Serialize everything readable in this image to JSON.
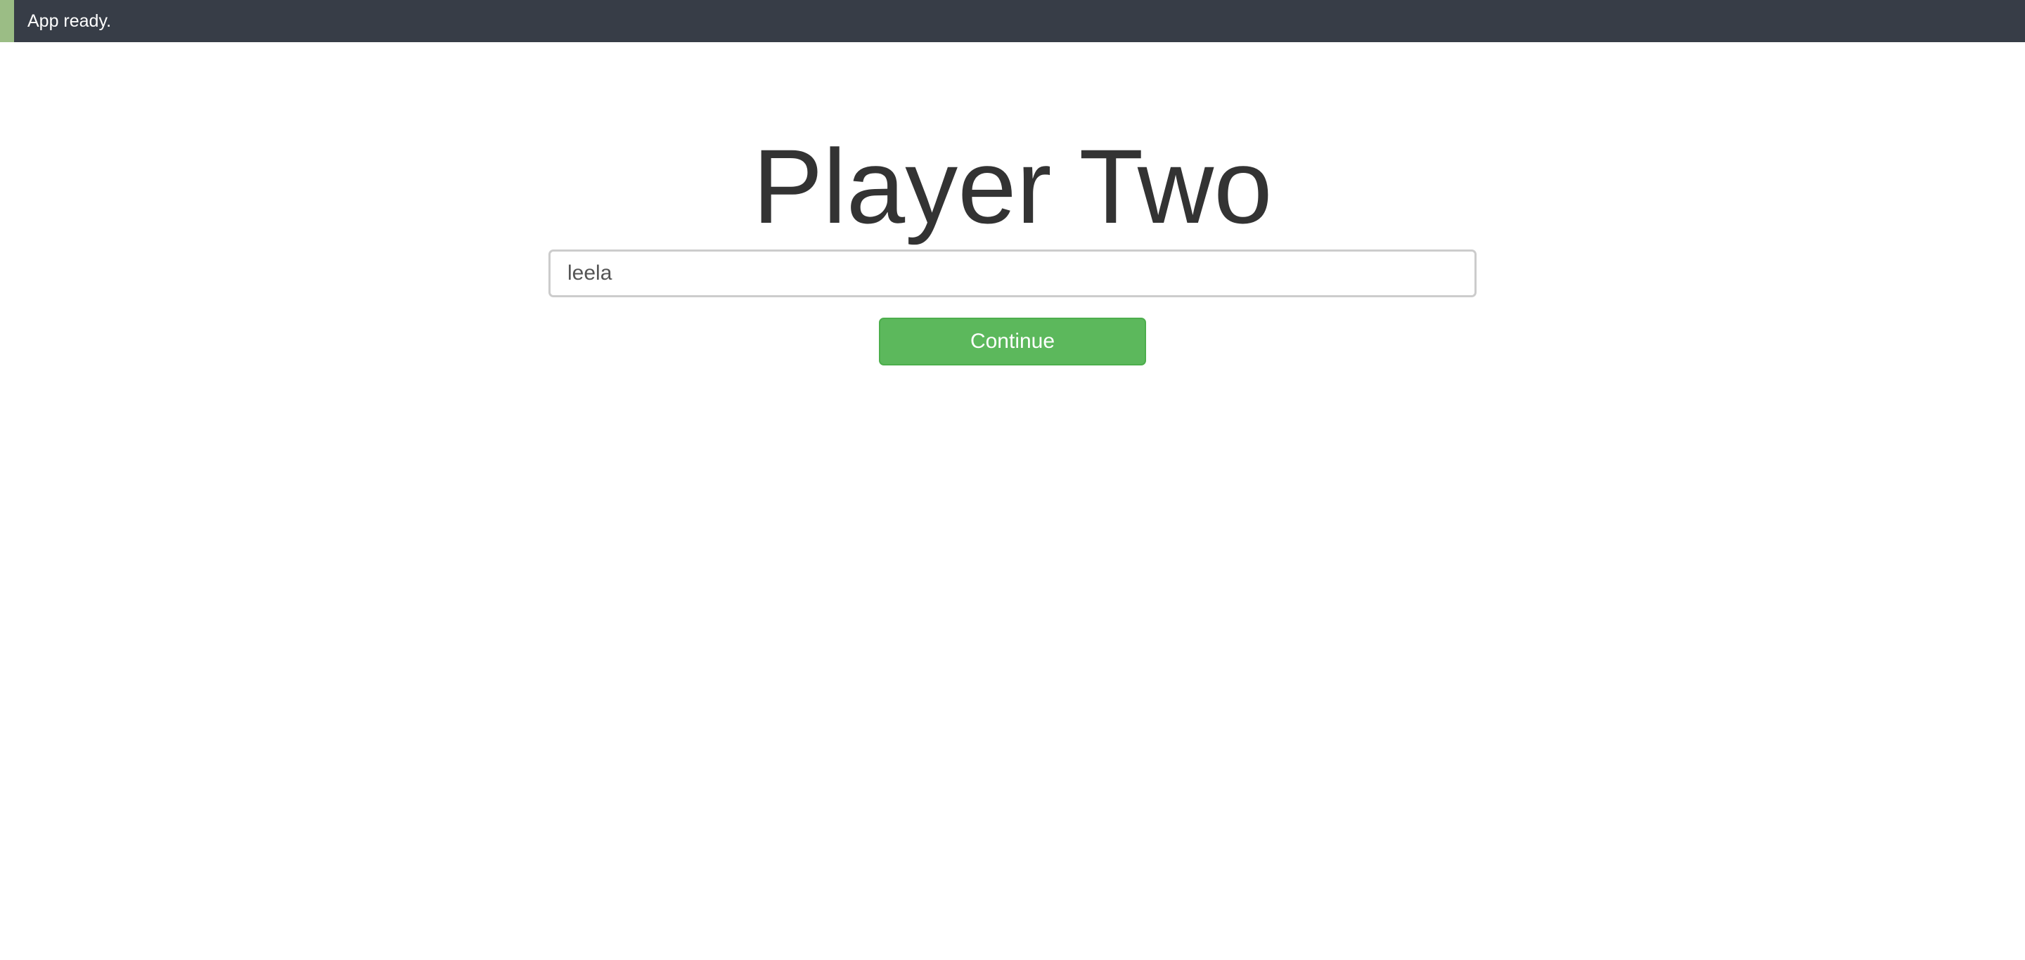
{
  "status_bar": {
    "message": "App ready.",
    "accent_color": "#9bbd85",
    "background_color": "#373d47"
  },
  "main": {
    "title": "Player Two",
    "name_input": {
      "value": "leela",
      "placeholder": ""
    },
    "continue_button": {
      "label": "Continue",
      "color": "#5cb85c"
    }
  }
}
